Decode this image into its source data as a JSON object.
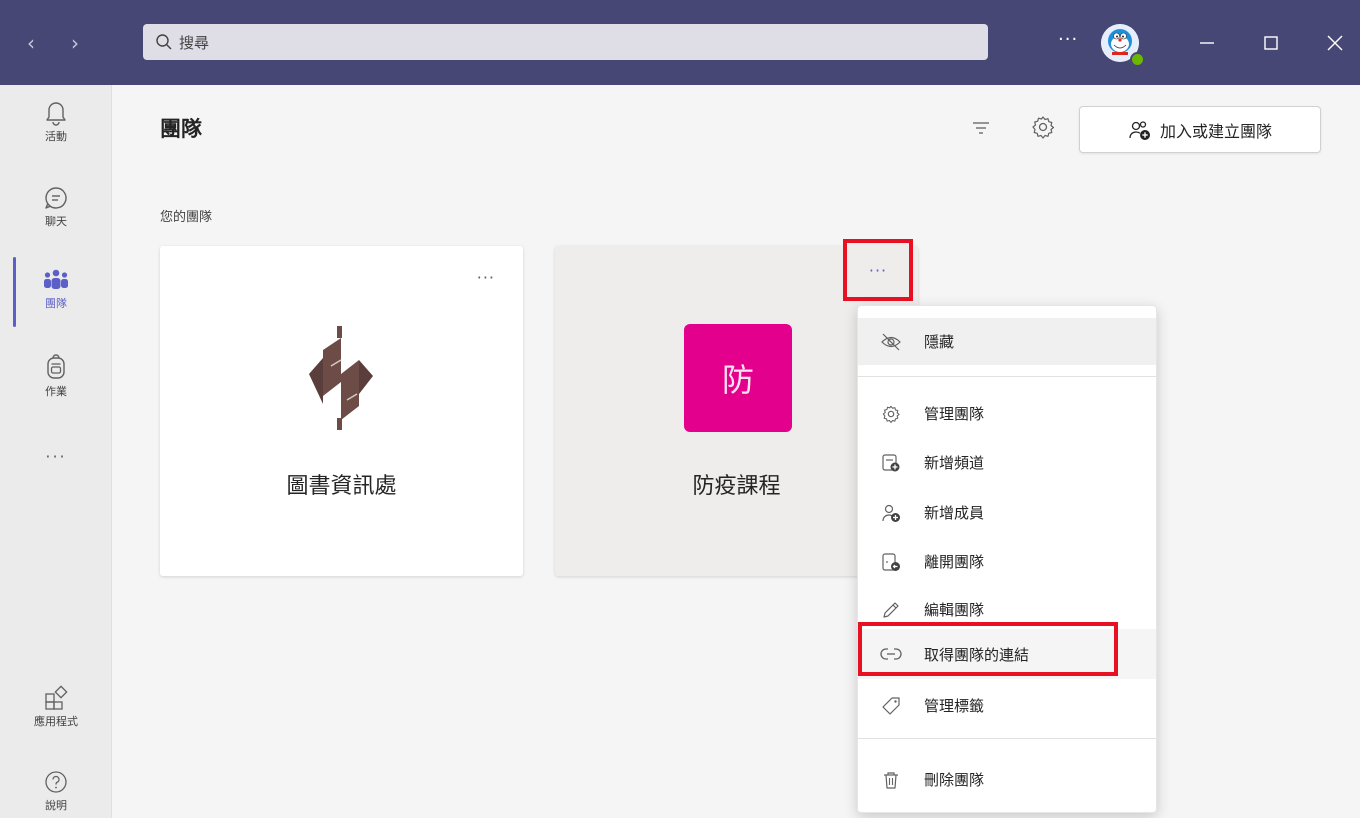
{
  "titlebar": {
    "back_glyph": "‹",
    "forward_glyph": "›",
    "search_placeholder": "搜尋",
    "more_glyph": "···",
    "user_status_color": "#6bb700",
    "icons": [
      "search-icon",
      "minimize-icon",
      "maximize-icon",
      "close-icon"
    ]
  },
  "rail": {
    "items": [
      {
        "label": "活動",
        "icon": "bell-icon"
      },
      {
        "label": "聊天",
        "icon": "chat-icon"
      },
      {
        "label": "團隊",
        "icon": "teams-icon",
        "active": true
      },
      {
        "label": "作業",
        "icon": "backpack-icon"
      },
      {
        "label": "應用程式",
        "icon": "apps-icon"
      },
      {
        "label": "說明",
        "icon": "help-icon"
      }
    ],
    "more_glyph": "···"
  },
  "header": {
    "title": "團隊",
    "join_label": "加入或建立團隊"
  },
  "section": {
    "label": "您的團隊"
  },
  "teams": [
    {
      "name": "圖書資訊處",
      "more_glyph": "···"
    },
    {
      "name": "防疫課程",
      "tile_char": "防",
      "tile_color": "#e3008c",
      "more_glyph": "···"
    }
  ],
  "menu": {
    "items": [
      {
        "label": "隱藏",
        "icon": "eye-off-icon"
      },
      {
        "label": "管理團隊",
        "icon": "gear-icon"
      },
      {
        "label": "新增頻道",
        "icon": "add-channel-icon"
      },
      {
        "label": "新增成員",
        "icon": "add-member-icon"
      },
      {
        "label": "離開團隊",
        "icon": "leave-team-icon"
      },
      {
        "label": "編輯團隊",
        "icon": "pencil-icon"
      },
      {
        "label": "取得團隊的連結",
        "icon": "link-icon"
      },
      {
        "label": "管理標籤",
        "icon": "tag-icon"
      },
      {
        "label": "刪除團隊",
        "icon": "trash-icon"
      }
    ]
  },
  "colors": {
    "titlebar": "#464775",
    "accent": "#5b5fc7",
    "highlight": "#e81123"
  }
}
